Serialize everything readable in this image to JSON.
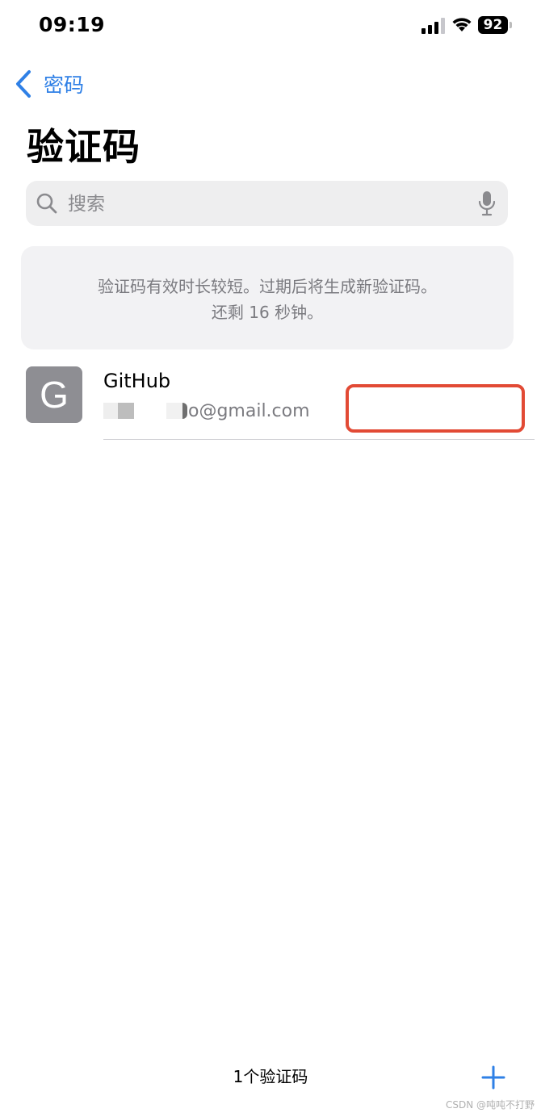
{
  "status_bar": {
    "time": "09:19",
    "battery_level": "92"
  },
  "nav": {
    "back_label": "密码",
    "title": "验证码"
  },
  "search": {
    "placeholder": "搜索"
  },
  "info_card": {
    "line1": "验证码有效时长较短。过期后将生成新验证码。",
    "line2": "还剩 16 秒钟。"
  },
  "items": [
    {
      "avatar_letter": "G",
      "title": "GitHub",
      "account_suffix": "o@gmail.com"
    }
  ],
  "toolbar": {
    "count_label": "1个验证码"
  },
  "watermark": "CSDN @吨吨不打野",
  "colors": {
    "accent": "#2f80e6",
    "highlight": "#e24a35",
    "avatar": "#8e8e93"
  }
}
